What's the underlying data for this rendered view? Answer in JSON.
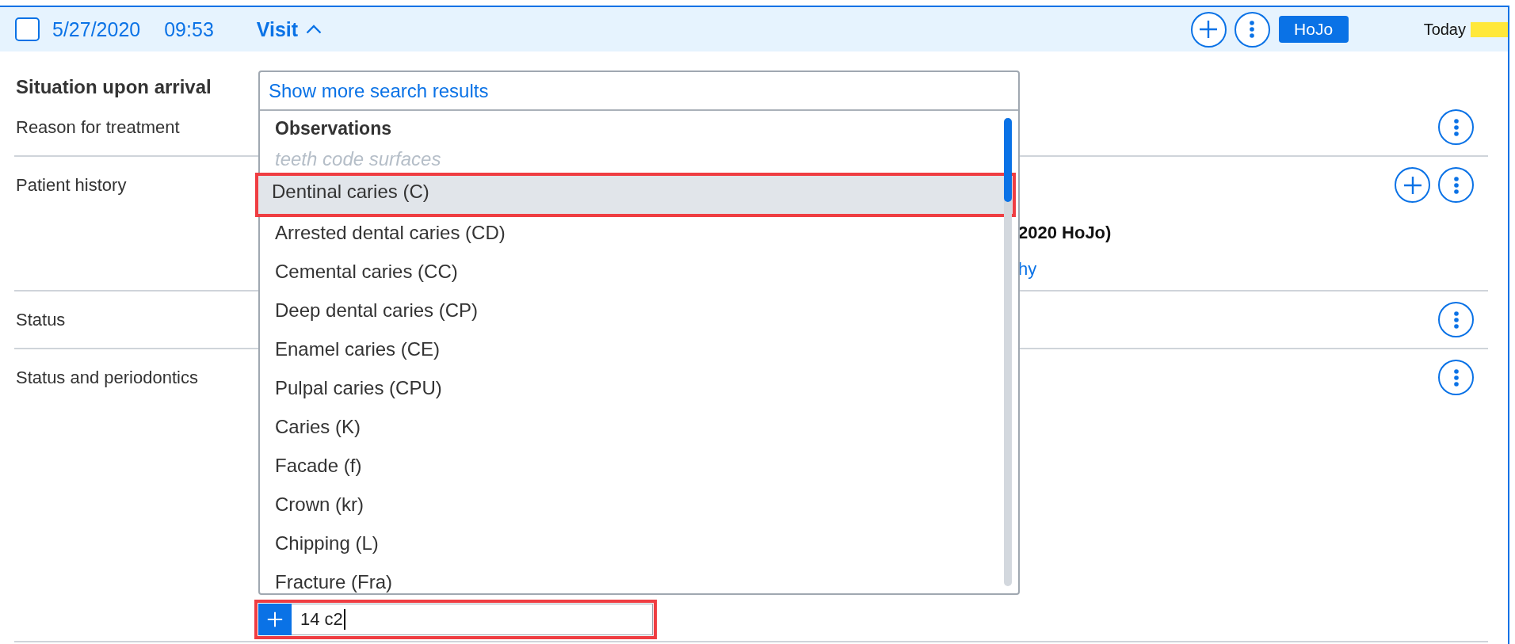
{
  "visit_header": {
    "checked": false,
    "date": "5/27/2020",
    "time": "09:53",
    "title": "Visit",
    "expanded": true,
    "buttons": [
      {
        "kind": "add"
      },
      {
        "kind": "more"
      }
    ],
    "author": "HoJo",
    "day_label": "Today"
  },
  "section": {
    "title": "Situation upon arrival"
  },
  "rows": [
    {
      "label": "Reason for treatment",
      "buttons": [
        {
          "kind": "more"
        }
      ]
    },
    {
      "label": "Patient history",
      "buttons": [
        {
          "kind": "add"
        },
        {
          "kind": "more"
        }
      ],
      "lines": [
        {
          "kind": "text",
          "text": "2020 HoJo)"
        },
        {
          "kind": "link",
          "text": "hy"
        }
      ]
    },
    {
      "label": "Status",
      "buttons": [
        {
          "kind": "more"
        }
      ]
    },
    {
      "label": "Status and periodontics",
      "buttons": [
        {
          "kind": "more"
        }
      ],
      "entry": {
        "value": "14 c2",
        "focused": true,
        "highlighted": true,
        "suggestions": {
          "more_link": "Show more search results",
          "group": "Observations",
          "hint": "teeth code surfaces",
          "items": [
            {
              "label": "Dentinal caries (C)",
              "selected": true
            },
            {
              "label": "Arrested dental caries (CD)",
              "selected": false
            },
            {
              "label": "Cemental caries (CC)",
              "selected": false
            },
            {
              "label": "Deep dental caries (CP)",
              "selected": false
            },
            {
              "label": "Enamel caries (CE)",
              "selected": false
            },
            {
              "label": "Pulpal caries (CPU)",
              "selected": false
            },
            {
              "label": "Caries (K)",
              "selected": false
            },
            {
              "label": "Facade (f)",
              "selected": false
            },
            {
              "label": "Crown (kr)",
              "selected": false
            },
            {
              "label": "Chipping (L)",
              "selected": false
            },
            {
              "label": "Fracture (Fra)",
              "selected": false
            }
          ]
        }
      }
    }
  ]
}
